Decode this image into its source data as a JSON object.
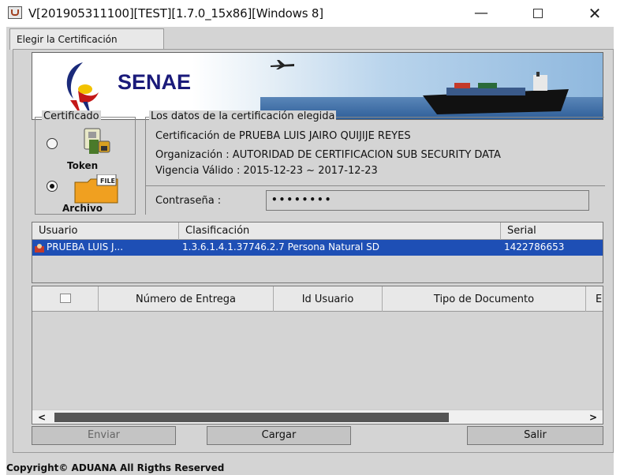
{
  "window": {
    "title": "V[201905311100][TEST][1.7.0_15x86][Windows 8]",
    "minimize_glyph": "—",
    "close_glyph": "✕"
  },
  "tabs": [
    {
      "label": "Elegir la Certificación",
      "selected": true
    }
  ],
  "banner": {
    "logo_text": "SENAE"
  },
  "certificado_group": {
    "legend": "Certificado",
    "options": [
      {
        "label": "Token",
        "checked": false,
        "icon": "usb-token-icon"
      },
      {
        "label": "Archivo",
        "checked": true,
        "icon": "file-folder-icon",
        "icon_text": "FILE"
      }
    ]
  },
  "datos_group": {
    "legend": "Los datos de la certificación elegida",
    "certificacion": "Certificación de PRUEBA LUIS JAIRO QUIJIJE REYES",
    "organizacion": "Organización : AUTORIDAD DE CERTIFICACION SUB SECURITY DATA",
    "vigencia": "Vigencia Válido : 2015-12-23 ~ 2017-12-23",
    "password_label": "Contraseña :",
    "password_value": "••••••••"
  },
  "cert_table": {
    "columns": [
      "Usuario",
      "Clasificación",
      "Serial"
    ],
    "rows": [
      [
        "PRUEBA LUIS J...",
        "1.3.6.1.4.1.37746.2.7 Persona Natural SD",
        "1422786653"
      ]
    ],
    "selected_row": 0,
    "selection_color": "#1e4fb5"
  },
  "docs_table": {
    "columns": [
      "Número de Entrega",
      "Id Usuario",
      "Tipo de Documento",
      "E"
    ],
    "scroll_left": "<",
    "scroll_right": ">"
  },
  "buttons": {
    "enviar": "Enviar",
    "cargar": "Cargar",
    "salir": "Salir"
  },
  "footer": "Copyright© ADUANA All Rigths Reserved"
}
